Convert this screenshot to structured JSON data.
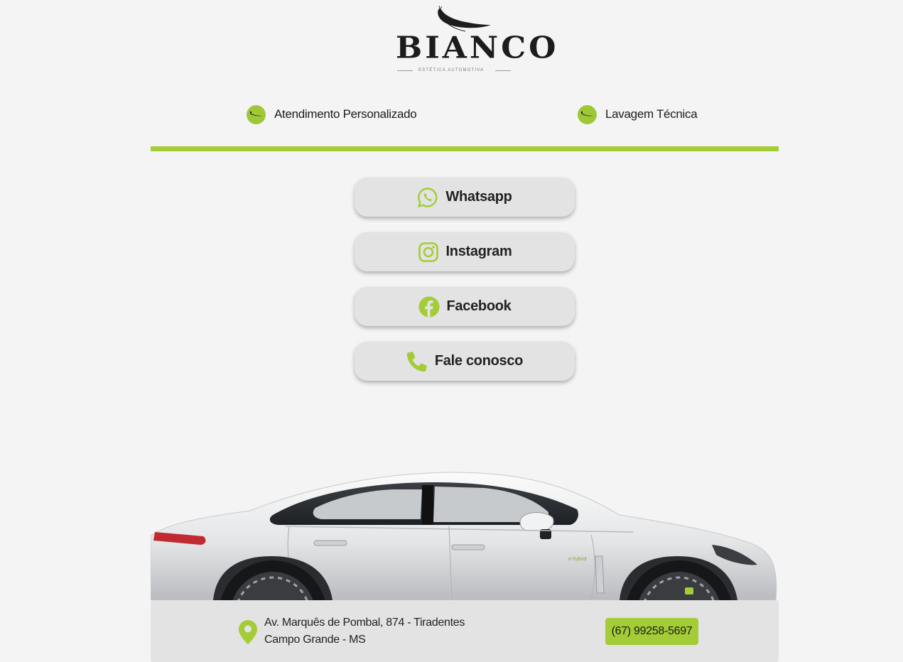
{
  "brand": {
    "wordmark": "BIANCO",
    "tagline": "ESTÉTICA AUTOMOTIVA",
    "accent_color": "#a3cc36"
  },
  "features": [
    {
      "icon": "peacock-badge-icon",
      "label": "Atendimento Personalizado"
    },
    {
      "icon": "peacock-badge-icon",
      "label": "Lavagem Técnica"
    }
  ],
  "links": [
    {
      "icon": "whatsapp-icon",
      "label": "Whatsapp"
    },
    {
      "icon": "instagram-icon",
      "label": "Instagram"
    },
    {
      "icon": "facebook-icon",
      "label": "Facebook"
    },
    {
      "icon": "phone-icon",
      "label": "Fale conosco"
    }
  ],
  "footer": {
    "icon": "location-pin-icon",
    "address_line1": "Av. Marquês de Pombal, 874 - Tiradentes",
    "address_line2": "Campo Grande - MS",
    "phone": "(67) 99258-5697"
  }
}
